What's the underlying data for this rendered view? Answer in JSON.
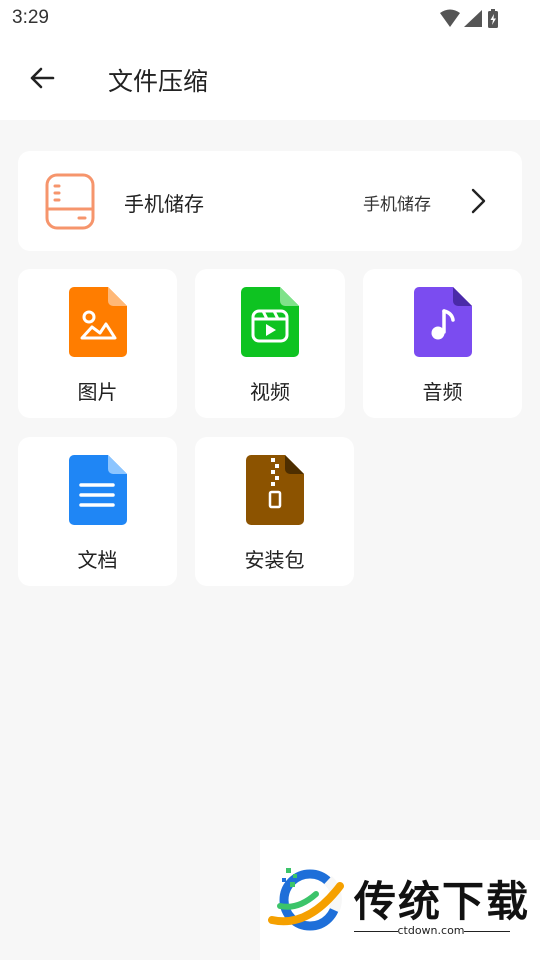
{
  "status_bar": {
    "time": "3:29"
  },
  "app_bar": {
    "title": "文件压缩"
  },
  "storage": {
    "label": "手机储存",
    "value": "手机储存"
  },
  "categories": [
    {
      "label": "图片",
      "icon": "image-icon",
      "color": "#ff7d00"
    },
    {
      "label": "视频",
      "icon": "video-icon",
      "color": "#0ec321"
    },
    {
      "label": "音频",
      "icon": "music-icon",
      "color": "#7b4cf0"
    },
    {
      "label": "文档",
      "icon": "document-icon",
      "color": "#1f86f5"
    },
    {
      "label": "安装包",
      "icon": "zip-icon",
      "color": "#8c5300"
    }
  ],
  "colors": {
    "storage_icon": "#f6956c"
  },
  "watermark": {
    "text": "传统下载",
    "url": "ctdown.com"
  }
}
